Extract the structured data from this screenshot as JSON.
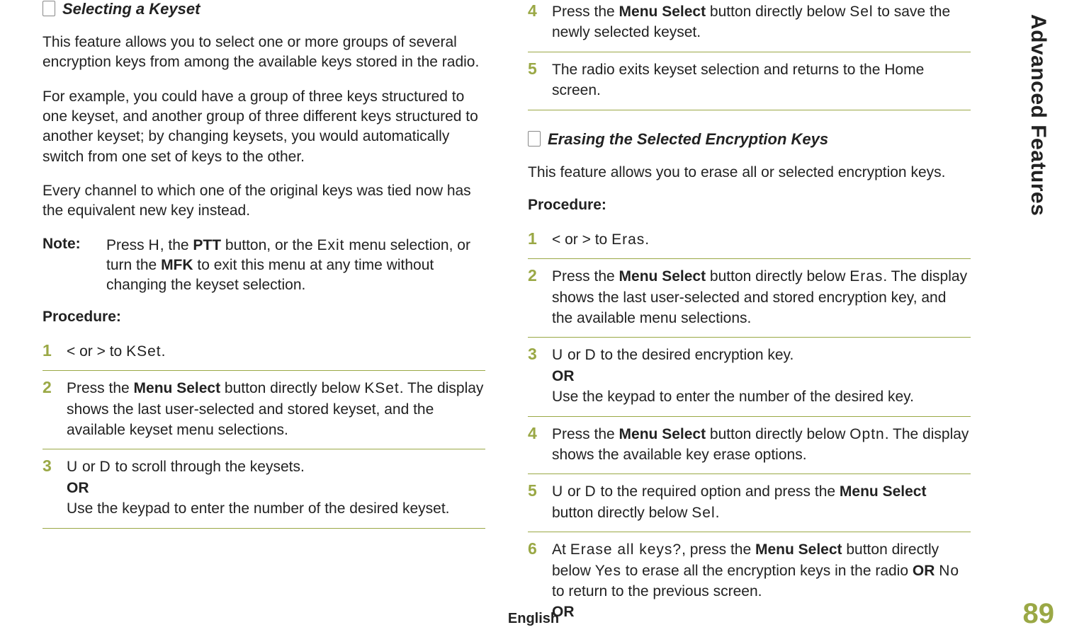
{
  "sideLabel": "Advanced Features",
  "pageNumber": "89",
  "bottomLabel": "English",
  "left": {
    "heading": "Selecting a Keyset",
    "p1": "This feature allows you to select one or more groups of several encryption keys from among the available keys stored in the radio.",
    "p2": "For example, you could have a group of three keys structured to one keyset, and another group of three different keys structured to another keyset; by changing keysets, you would automatically switch from one set of keys to the other.",
    "p3": "Every channel to which one of the original keys was tied now has the equivalent new key instead.",
    "noteLabel": "Note:",
    "note_a": "Press ",
    "note_H": "H",
    "note_b": ", the ",
    "note_PTT": "PTT",
    "note_c": " button, or the ",
    "note_Exit": "Exit",
    "note_d": " menu selection, or turn the ",
    "note_MFK": "MFK",
    "note_e": " to exit this menu at any time without changing the keyset selection.",
    "procLabel": "Procedure:",
    "s1_a": "< or > to ",
    "s1_code": "KSet",
    "s1_b": ".",
    "s2_a": "Press the ",
    "s2_b": "Menu Select",
    "s2_c": " button directly below ",
    "s2_code": "KSet",
    "s2_d": ". The display shows the last user-selected and stored keyset, and the available keyset menu selections.",
    "s3_a": "U",
    "s3_b": " or ",
    "s3_c": "D",
    "s3_d": " to scroll through the keysets.",
    "s3_or": "OR",
    "s3_e": "Use the keypad to enter the number of the desired keyset."
  },
  "right": {
    "s4_a": "Press the ",
    "s4_b": "Menu Select",
    "s4_c": " button directly below ",
    "s4_code": "Sel",
    "s4_d": " to save the newly selected keyset.",
    "s5": "The radio exits keyset selection and returns to the Home screen.",
    "heading": "Erasing the Selected Encryption Keys",
    "p1": "This feature allows you to erase all or selected encryption keys.",
    "procLabel": "Procedure:",
    "e1_a": "< or > to ",
    "e1_code": "Eras",
    "e1_b": ".",
    "e2_a": "Press the ",
    "e2_b": "Menu Select",
    "e2_c": " button directly below ",
    "e2_code": "Eras",
    "e2_d": ". The display shows the last user-selected and stored encryption key, and the available menu selections.",
    "e3_a": "U",
    "e3_b": " or ",
    "e3_c": "D",
    "e3_d": " to the desired encryption key.",
    "e3_or": "OR",
    "e3_e": "Use the keypad to enter the number of the desired key.",
    "e4_a": "Press the ",
    "e4_b": "Menu Select",
    "e4_c": " button directly below ",
    "e4_code": "Optn",
    "e4_d": ". The display shows the available key erase options.",
    "e5_a": "U",
    "e5_b": " or ",
    "e5_c": "D",
    "e5_d": " to the required option and press the ",
    "e5_e": "Menu Select",
    "e5_f": " button directly below ",
    "e5_code": "Sel",
    "e5_g": ".",
    "e6_a": "At ",
    "e6_code1": "Erase all keys?",
    "e6_b": ", press the ",
    "e6_c": "Menu Select",
    "e6_d": " button directly below ",
    "e6_code2": "Yes",
    "e6_e": " to erase all the encryption keys in the radio ",
    "e6_or1": "OR",
    "e6_f": " ",
    "e6_code3": "No",
    "e6_g": " to return to the previous screen.",
    "e6_or2": "OR"
  }
}
